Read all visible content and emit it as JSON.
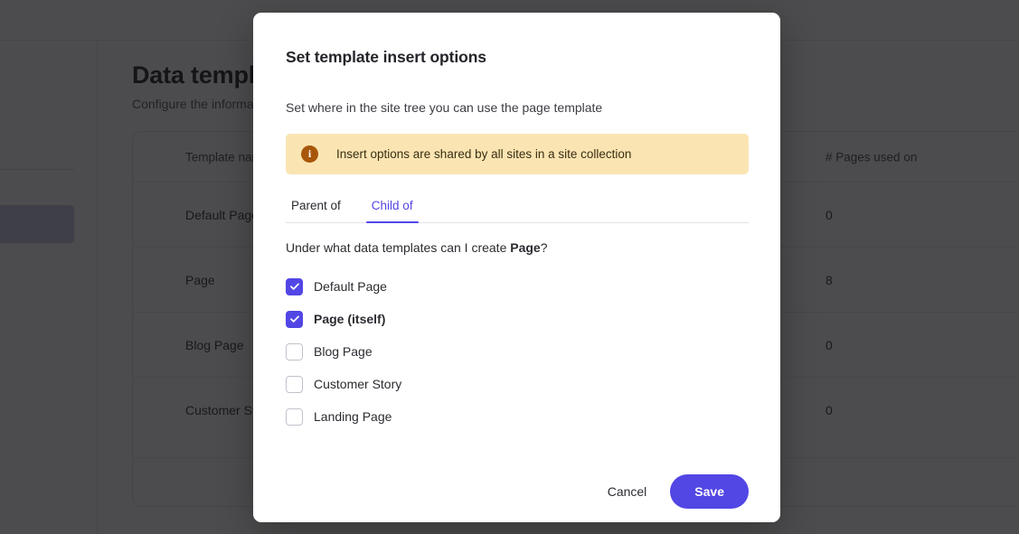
{
  "background": {
    "page_title": "Data templates",
    "page_subtitle": "Configure the information structure of your site",
    "table": {
      "headers": [
        "Template name",
        "# Pages used on"
      ],
      "rows": [
        {
          "name": "Default Page",
          "pages_used_on": "0"
        },
        {
          "name": "Page",
          "pages_used_on": "8"
        },
        {
          "name": "Blog Page",
          "pages_used_on": "0"
        },
        {
          "name": "Customer Story",
          "pages_used_on": "0"
        }
      ]
    }
  },
  "modal": {
    "title": "Set template insert options",
    "close_icon": "close-icon",
    "description": "Set where in the site tree you can use the page template",
    "banner": {
      "icon": "info-icon",
      "icon_glyph": "i",
      "text": "Insert options are shared by all sites in a site collection",
      "background_color": "#fae5b2",
      "icon_color": "#a8570a"
    },
    "tabs": [
      {
        "label": "Parent of",
        "active": false
      },
      {
        "label": "Child of",
        "active": true
      }
    ],
    "question_prefix": "Under what data templates can I create ",
    "question_bold": "Page",
    "question_suffix": "?",
    "options": [
      {
        "label": "Default Page",
        "checked": true,
        "bold": false
      },
      {
        "label": "Page (itself)",
        "checked": true,
        "bold": true
      },
      {
        "label": "Blog Page",
        "checked": false,
        "bold": false
      },
      {
        "label": "Customer Story",
        "checked": false,
        "bold": false
      },
      {
        "label": "Landing Page",
        "checked": false,
        "bold": false
      }
    ],
    "cancel_label": "Cancel",
    "save_label": "Save",
    "accent_color": "#5246e5"
  }
}
